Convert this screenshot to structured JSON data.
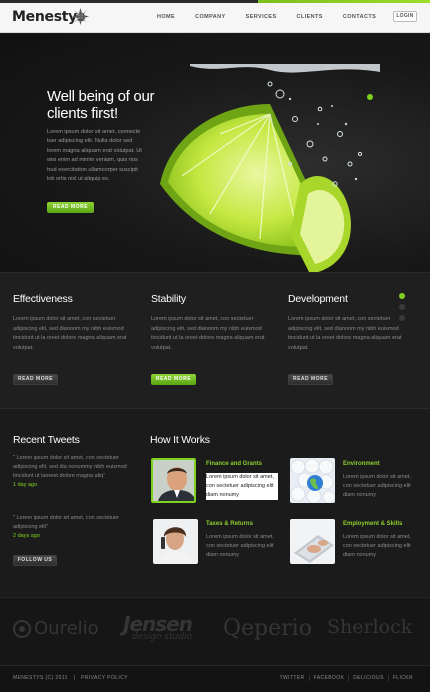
{
  "header": {
    "logo": "Menestys",
    "nav": [
      "HOME",
      "COMPANY",
      "SERVICES",
      "CLIENTS",
      "CONTACTS"
    ],
    "login": "LOGIN"
  },
  "hero": {
    "title_line1": "Well being of our",
    "title_line2": "clients first!",
    "text": "Lorem ipsum dolor sit amet, connecte tuer adipiscing elit. Nulla dolor sed lorem magna aliquam erat volutpat. Ut wisi enim ad minim veniam, quis nos trud exercitation ullamcorper suscipit lob ortis nisl ut aliquip ex.",
    "button": "READ MORE"
  },
  "features": [
    {
      "title": "Effectiveness",
      "text": "Lorem ipsum dolor sit amet, con sectetuer adipiscing elit, sed dianonm my nibh euismod tincidunt ut la oreet dolore magna aliquam erat volutpat.",
      "button": "READ MORE"
    },
    {
      "title": "Stability",
      "text": "Lorem ipsum dolor sit amet, con sectetuer adipiscing elit, sed dianonm my nibh euismod tincidunt ut la oreet dolore magna aliquam erat volutpat.",
      "button": "READ MORE"
    },
    {
      "title": "Development",
      "text": "Lorem ipsum dolor sit amet, con sectetuer adipiscing elit, sed dianonm my nibh euismod tincidunt ut la oreet dolore magna aliquam erat volutpat.",
      "button": "READ MORE"
    }
  ],
  "tweets": {
    "title": "Recent Tweets",
    "items": [
      {
        "text": "\" Lorem ipsum dolor sit amet, con sectetuer adipiscing elit, sed dia nonummy nibh euismod tincidunt ut laoreet dolore magna aliq\"",
        "date": "1 day ago"
      },
      {
        "text": "\" Lorem ipsum dolor sit amet, con sectetuer adipiscing elit\"",
        "date": "2 days ago"
      }
    ],
    "button": "FOLLOW US"
  },
  "how": {
    "title": "How It Works",
    "items": [
      {
        "title": "Finance and Grants",
        "text": "Lorem ipsum dolor sit amet, con sectetuer adipiscing elit diam nonumy"
      },
      {
        "title": "Environment",
        "text": "Lorem ipsum dolor sit amet, con sectetuer adipiscing elit diam nonumy"
      },
      {
        "title": "Taxes & Returns",
        "text": "Lorem ipsum dolor sit amet, con sectetuer adipiscing elit diam nonumy"
      },
      {
        "title": "Employment & Skills",
        "text": "Lorem ipsum dolor sit amet, con sectetuer adipiscing elit diam nonumy"
      }
    ]
  },
  "clients": [
    "Ourelio",
    "Jensen",
    "design studio",
    "Qeperio",
    "Sherlock"
  ],
  "footer": {
    "copyright": "MENESTYS (C) 2011",
    "separator": "|",
    "privacy": "PRIVACY POLICY",
    "links": [
      "TWITTER",
      "FACEBOOK",
      "DELICIOUS",
      "FLICKR"
    ]
  },
  "colors": {
    "accent": "#7ed321",
    "background": "#1b1b1b"
  }
}
